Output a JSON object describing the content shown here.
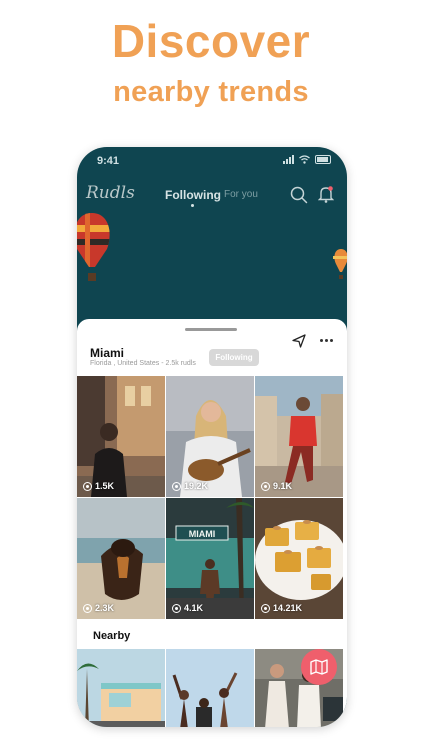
{
  "promo": {
    "headline": "Discover",
    "subheadline": "nearby trends"
  },
  "status_bar": {
    "time": "9:41"
  },
  "app": {
    "logo": "Rudls",
    "tabs": [
      {
        "label": "Following",
        "active": true
      },
      {
        "label": "For you",
        "active": false
      }
    ]
  },
  "location": {
    "city": "Miami",
    "details": "Florida , United States - 2.5k rudls",
    "follow_label": "Following"
  },
  "posts": [
    {
      "views": "1.5K",
      "subject": "woman filming on city street"
    },
    {
      "views": "19.2K",
      "subject": "woman playing guitar"
    },
    {
      "views": "9.1K",
      "subject": "basketball player running"
    },
    {
      "views": "2.3K",
      "subject": "dog running on beach"
    },
    {
      "views": "4.1K",
      "subject": "man in front of Miami sign"
    },
    {
      "views": "14.21K",
      "subject": "dessert squares on plate"
    }
  ],
  "nearby": {
    "title": "Nearby",
    "items": [
      {
        "subject": "food truck"
      },
      {
        "subject": "people dancing"
      },
      {
        "subject": "women in street"
      }
    ]
  },
  "colors": {
    "accent": "#f0a155",
    "header_bg": "#0f4550",
    "fab": "#ef5f6c"
  },
  "icons": [
    "search-icon",
    "bell-icon",
    "navigation-icon",
    "more-icon",
    "views-icon",
    "map-icon"
  ]
}
